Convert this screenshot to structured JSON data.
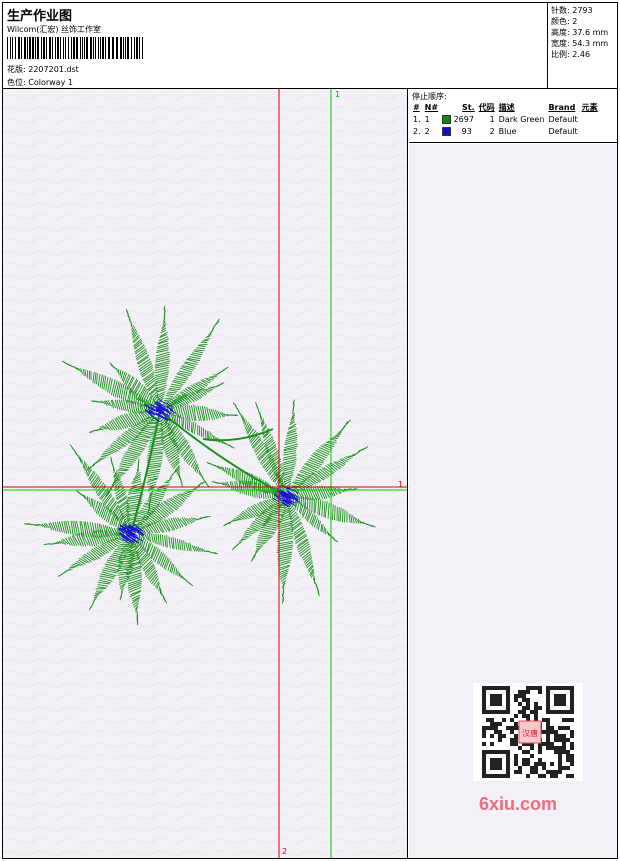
{
  "header": {
    "title": "生产作业图",
    "subtitle": "Wilcom(汇宏) 丝饰工作室",
    "design_label": "花版:",
    "design_value": "2207201.dst",
    "colorway_label": "色位:",
    "colorway_value": "Colorway 1"
  },
  "stats": [
    {
      "label": "针数:",
      "value": "2793"
    },
    {
      "label": "颜色:",
      "value": "2"
    },
    {
      "label": "高度:",
      "value": "37.6 mm"
    },
    {
      "label": "宽度:",
      "value": "54.3 mm"
    },
    {
      "label": "比例:",
      "value": "2.46"
    }
  ],
  "stop_sequence": {
    "title": "停止顺序:",
    "columns": [
      "#",
      "N#",
      "St.",
      "代码",
      "描述",
      "Brand",
      "元素"
    ],
    "rows": [
      {
        "index": "1.",
        "n": "1",
        "color": "#0a8a0a",
        "stitches": "2697",
        "code": "1",
        "description": "Dark Green",
        "brand": "Default",
        "element": ""
      },
      {
        "index": "2.",
        "n": "2",
        "color": "#1010cc",
        "stitches": "93",
        "code": "2",
        "description": "Blue",
        "brand": "Default",
        "element": ""
      }
    ]
  },
  "guides": {
    "vertical_green_label": "1",
    "vertical_red_label": "2",
    "horizontal_label": "1",
    "red_color": "#dd0000",
    "green_color": "#00cc00"
  },
  "watermark": {
    "brand_text": "6xiu.com",
    "qr_badge": "汉唐"
  },
  "palette": {
    "petal_green": "#1a8f1a",
    "center_blue": "#1818c8",
    "background": "#f3f1f7"
  }
}
